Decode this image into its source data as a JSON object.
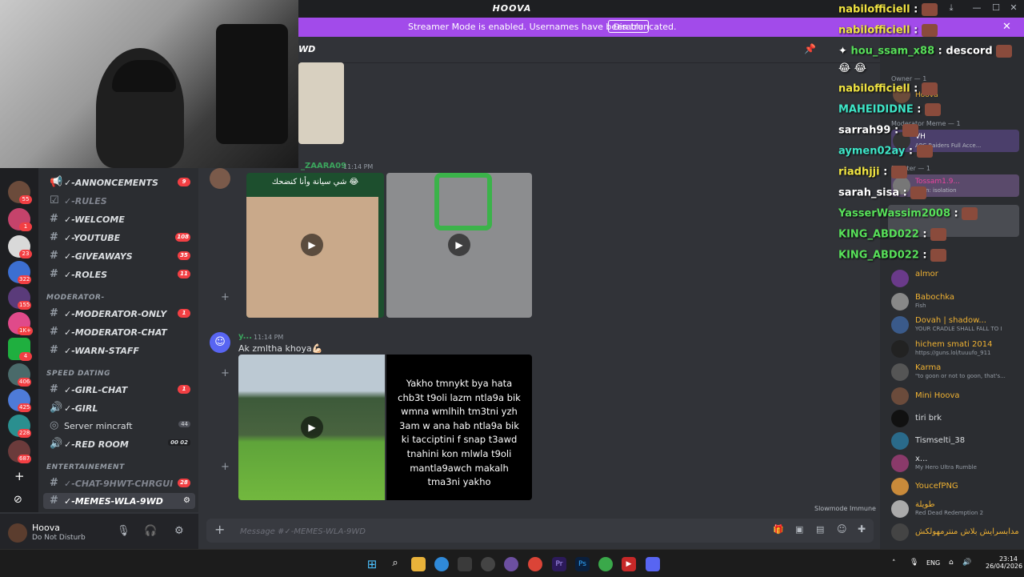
{
  "app": {
    "title": "HOOVA"
  },
  "banner": {
    "text": "Streamer Mode is enabled. Usernames have been truncated.",
    "disable_label": "Disable"
  },
  "channel_header": {
    "name": "WD"
  },
  "servers": [
    {
      "badge": "55"
    },
    {
      "badge": "1"
    },
    {
      "badge": "23"
    },
    {
      "badge": "322"
    },
    {
      "badge": "155"
    },
    {
      "badge": "1K+"
    },
    {
      "badge": "4"
    },
    {
      "badge": "406"
    },
    {
      "badge": "425"
    },
    {
      "badge": "228"
    },
    {
      "badge": "687"
    }
  ],
  "channels": [
    {
      "name": "✓-ANNONCEMENTS",
      "count": "9"
    },
    {
      "name": "✓-RULES",
      "count": ""
    },
    {
      "name": "✓-WELCOME",
      "count": ""
    },
    {
      "name": "✓-YOUTUBE",
      "count": "108"
    },
    {
      "name": "✓-GIVEAWAYS",
      "count": "35"
    },
    {
      "name": "✓-ROLES",
      "count": "11"
    }
  ],
  "cat_moderator": "MODERATOR-",
  "mod_channels": [
    {
      "name": "✓-MODERATOR-ONLY",
      "count": "1"
    },
    {
      "name": "✓-MODERATOR-CHAT",
      "count": ""
    },
    {
      "name": "✓-WARN-STAFF",
      "count": ""
    }
  ],
  "cat_speed": "SPEED DATING",
  "speed_channels": [
    {
      "name": "✓-GIRL-CHAT",
      "count": "1"
    },
    {
      "name": "✓-GIRL",
      "count": ""
    },
    {
      "name": "Server mincraft",
      "count": "44"
    },
    {
      "name": "✓-RED ROOM",
      "count": "00 02"
    }
  ],
  "cat_ent": "ENTERTAINEMENT",
  "ent_channels": [
    {
      "name": "✓-CHAT-9HWT-CHRGUI",
      "count": "28"
    },
    {
      "name": "✓-MEMES-WLA-9WD",
      "count": ""
    }
  ],
  "user": {
    "name": "Hoova",
    "status": "Do Not Disturb"
  },
  "messages": [
    {
      "author": "_ZAARA09",
      "time": "11:14 PM",
      "caption": "شي سيانة وأنا كنضحك 😂"
    },
    {
      "author": "y...",
      "time": "11:14 PM",
      "text": "Ak zmltha khoya💪🏻",
      "image_text": "Yakho tmnykt bya hata chb3t t9oli lazm ntla9a bik wmna wmlhih tm3tni yzh 3am w ana hab ntla9a bik ki tacciptini f snap t3awd tnahini kon mlwla t9oli mantla9awch makalh tma3ni yakho"
    }
  ],
  "composer": {
    "placeholder": "Message #✓-MEMES-WLA-9WD"
  },
  "slowmode": "Slowmode Immune",
  "role_headers": {
    "owner": "Owner — 1",
    "mod": "Moderator Meme — 1",
    "booster": "Booster — 1"
  },
  "members_top": [
    {
      "name": "Hoova",
      "sub": ""
    },
    {
      "name": "VH",
      "sub": "ARC Raiders Full Acce..."
    },
    {
      "name": "Tossam1.9...",
      "sub": "Alien: isolation"
    }
  ],
  "members": [
    {
      "name": "almor",
      "sub": "",
      "color": "#f0b232"
    },
    {
      "name": "Babochka",
      "sub": "Fish",
      "color": "#f0b232"
    },
    {
      "name": "Dovah | shadow...",
      "sub": "YOUR CRADLE SHALL FALL TO I",
      "color": "#f0b232"
    },
    {
      "name": "hichem smati 2014",
      "sub": "https://guns.lol/tuuufo_911",
      "color": "#f0b232"
    },
    {
      "name": "Karma",
      "sub": "\"to goon or not to goon, that's...",
      "color": "#f0b232"
    },
    {
      "name": "Mini Hoova",
      "sub": "",
      "color": "#f0b232"
    },
    {
      "name": "tiri brk",
      "sub": "",
      "color": "#dbdee1"
    },
    {
      "name": "Tismselti_38",
      "sub": "",
      "color": "#dbdee1"
    },
    {
      "name": "x...",
      "sub": "My Hero Ultra Rumble",
      "color": "#dbdee1"
    },
    {
      "name": "YoucefPNG",
      "sub": "",
      "color": "#f0b232"
    },
    {
      "name": "طويلة",
      "sub": "Red Dead Redemption 2",
      "color": "#f0b232"
    },
    {
      "name": "مدابسرايش بلاش منترمهولكش",
      "sub": "",
      "color": "#f0b232"
    }
  ],
  "stream_chat": [
    {
      "user": "nabilofficiell",
      "color": "#f0e442",
      "msg": ""
    },
    {
      "user": "nabilofficiell",
      "color": "#f0e442",
      "msg": ""
    },
    {
      "user": "hou_ssam_x88",
      "color": "#58e05a",
      "msg": "descord"
    },
    {
      "user": "nabilofficiell",
      "color": "#f0e442",
      "msg": ""
    },
    {
      "user": "MAHEIDIDNE",
      "color": "#3ee6c8",
      "msg": ""
    },
    {
      "user": "sarrah99",
      "color": "#ffffff",
      "msg": ""
    },
    {
      "user": "aymen02ay",
      "color": "#3ee6c8",
      "msg": ""
    },
    {
      "user": "riadhjji",
      "color": "#f0e442",
      "msg": ""
    },
    {
      "user": "sarah_sisa",
      "color": "#ffffff",
      "msg": ""
    },
    {
      "user": "YasserWassim2008",
      "color": "#58e05a",
      "msg": ""
    },
    {
      "user": "KING_ABD022",
      "color": "#58e05a",
      "msg": ""
    },
    {
      "user": "KING_ABD022",
      "color": "#58e05a",
      "msg": ""
    }
  ],
  "taskbar": {
    "lang": "ENG",
    "time": "23:14",
    "date": "26/04/2026"
  }
}
